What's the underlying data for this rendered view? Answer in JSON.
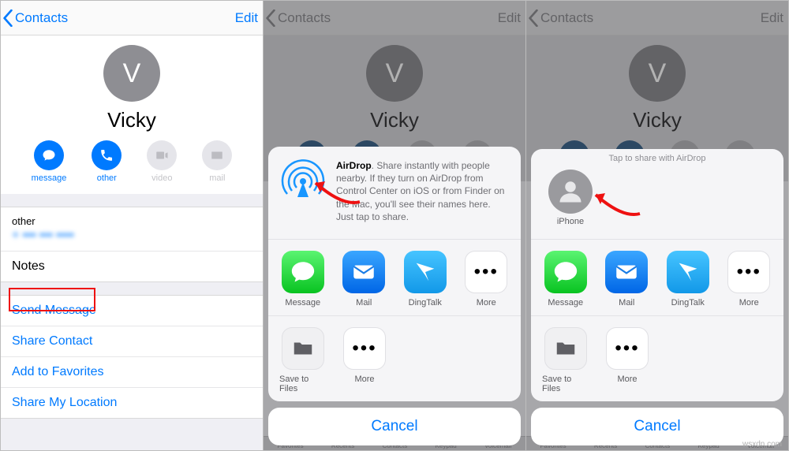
{
  "nav": {
    "back": "Contacts",
    "edit": "Edit"
  },
  "contact": {
    "initial": "V",
    "name": "Vicky"
  },
  "actions": {
    "message": "message",
    "other": "other",
    "video": "video",
    "mail": "mail"
  },
  "phone": {
    "label": "other",
    "value": "+ ••• ••• ••••"
  },
  "notes_label": "Notes",
  "links": {
    "send": "Send Message",
    "share": "Share Contact",
    "fav": "Add to Favorites",
    "loc": "Share My Location"
  },
  "airdrop": {
    "bold": "AirDrop",
    "text": ". Share instantly with people nearby. If they turn on AirDrop from Control Center on iOS or from Finder on the Mac, you'll see their names here. Just tap to share.",
    "hint": "Tap to share with AirDrop",
    "device": "iPhone"
  },
  "apps": {
    "message": "Message",
    "mail": "Mail",
    "dingtalk": "DingTalk",
    "more": "More",
    "save": "Save to Files"
  },
  "cancel": "Cancel",
  "tabs": {
    "fav": "Favorites",
    "recents": "Recents",
    "contacts": "Contacts",
    "keypad": "Keypad",
    "voicemail": "Voicemail"
  },
  "watermark": "wsxdn.com"
}
